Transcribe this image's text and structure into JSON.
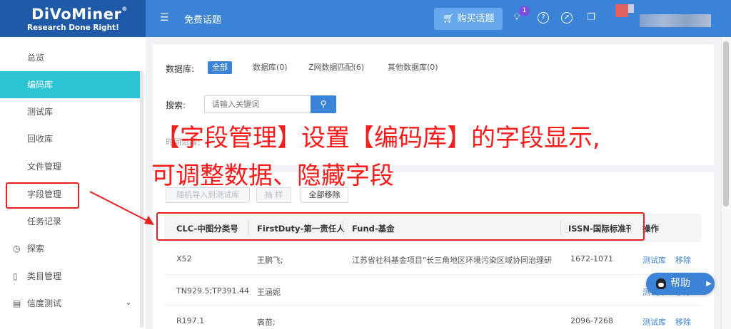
{
  "topbar": {
    "logo_title": "DiVoMiner",
    "logo_reg": "®",
    "logo_subtitle": "Research Done Right!",
    "menu_icon": "menu-toggle-icon",
    "page_heading": "免费话题",
    "buy_button": "购买话题",
    "notification_count": "1",
    "icons": [
      "lightbulb-icon",
      "help-icon",
      "compass-icon",
      "clipboard-icon"
    ]
  },
  "sidebar": {
    "items": [
      {
        "label": "总览",
        "icon": ""
      },
      {
        "label": "编码库",
        "icon": "",
        "active": true
      },
      {
        "label": "测试库",
        "icon": ""
      },
      {
        "label": "回收库",
        "icon": ""
      },
      {
        "label": "文件管理",
        "icon": ""
      },
      {
        "label": "字段管理",
        "icon": ""
      },
      {
        "label": "任务记录",
        "icon": ""
      },
      {
        "label": "探索",
        "icon": "explore-icon"
      },
      {
        "label": "类目管理",
        "icon": "category-icon"
      },
      {
        "label": "信度测试",
        "icon": "reliability-icon",
        "expandable": true
      }
    ]
  },
  "filters": {
    "database_label": "数据库:",
    "tabs": [
      "全部",
      "数据库(0)",
      "Z网数据匹配(6)",
      "其他数据库(0)"
    ],
    "active_tab": "全部",
    "search_label": "搜索:",
    "search_placeholder": "请输入关键词",
    "time_label": "时间范围:"
  },
  "actions": {
    "import_button": "随机导入到测试库",
    "sample_button": "抽 样",
    "remove_all_button": "全部移除"
  },
  "table": {
    "columns": [
      "CLC-中图分类号",
      "FirstDuty-第一责任人",
      "Fund-基金",
      "ISSN-国际标准刊号",
      "操作"
    ],
    "rows": [
      {
        "clc": "X52",
        "first_duty": "王鹏飞;",
        "fund": "江苏省社科基金项目\"长三角地区环境污染区域协同治理研",
        "issn": "1672-1071",
        "op1": "测试库",
        "op2": "移除"
      },
      {
        "clc": "TN929.5;TP391.44",
        "first_duty": "王涵妮",
        "fund": "",
        "issn": "",
        "op1": "测试库",
        "op2": "移除"
      },
      {
        "clc": "R197.1",
        "first_duty": "高苗;",
        "fund": "",
        "issn": "2096-7268",
        "op1": "测试库",
        "op2": "移除"
      }
    ]
  },
  "help_button": "帮助",
  "annotation": {
    "line1": "【字段管理】设置【编码库】的字段显示,",
    "line2": "可调整数据、隐藏字段"
  },
  "colors": {
    "topbar": "#3b83d6",
    "logo_bg": "#1f5aa8",
    "sidebar_active": "#2bc4d4",
    "annotation_red": "#ff1a1a",
    "link": "#3b83d6"
  }
}
